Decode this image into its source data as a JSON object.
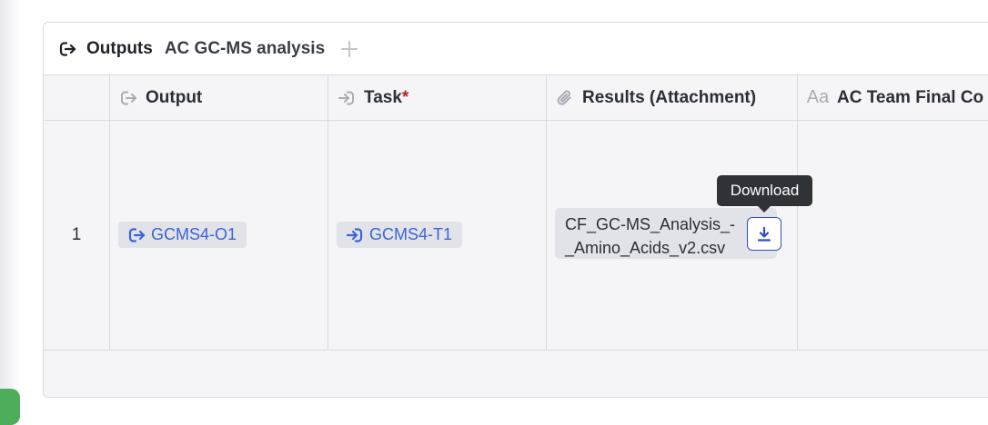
{
  "panel": {
    "title": "Outputs",
    "subtitle": "AC GC-MS analysis",
    "header_icon": "output-arrow-icon",
    "add_icon": "plus-icon"
  },
  "table": {
    "columns": [
      {
        "label": "Output",
        "icon": "output-arrow-icon",
        "required": false
      },
      {
        "label": "Task",
        "icon": "task-arrow-icon",
        "required": true,
        "required_mark": "*"
      },
      {
        "label": "Results (Attachment)",
        "icon": "paperclip-icon",
        "required": false
      },
      {
        "label": "AC Team Final Co",
        "icon": "text-aa-icon",
        "required": false
      }
    ],
    "rows": [
      {
        "number": "1",
        "output": "GCMS4-O1",
        "task": "GCMS4-T1",
        "attachment": "CF_GC-MS_Analysis_-_Amino_Acids_v2.csv",
        "attachment_line1": "CF_GC-MS_Analysis_-",
        "attachment_line2": "_Amino_Acids_v2.csv"
      }
    ]
  },
  "tooltip": {
    "text": "Download"
  },
  "colors": {
    "link": "#3c63d8",
    "chip_bg": "#e2e3e8",
    "grid_bg": "#f5f5f7",
    "border": "#d9dbe0",
    "required": "#b3261e",
    "tooltip_bg": "#2f3237",
    "download_border": "#2f4fc4"
  }
}
